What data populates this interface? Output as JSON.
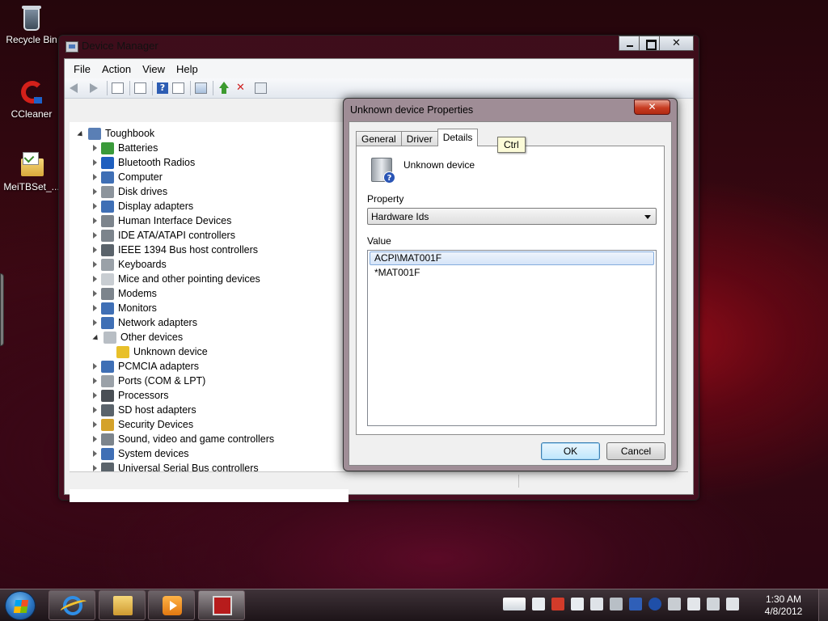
{
  "desktop": {
    "icons": [
      {
        "label": "Recycle Bin",
        "icon": "recycle-bin-icon"
      },
      {
        "label": "CCleaner",
        "icon": "ccleaner-icon"
      },
      {
        "label": "MeiTBSet_...",
        "icon": "settings-folder-icon"
      }
    ]
  },
  "device_manager": {
    "title": "Device Manager",
    "caption_buttons": {
      "close": "✕"
    },
    "menu": [
      "File",
      "Action",
      "View",
      "Help"
    ],
    "toolbar_help_glyph": "?",
    "toolbar_uninstall_glyph": "✕",
    "tree": {
      "root": "Toughbook",
      "items": [
        {
          "label": "Batteries",
          "icon": "battery-icon",
          "color": "#3a9a3a"
        },
        {
          "label": "Bluetooth Radios",
          "icon": "bluetooth-icon",
          "color": "#1f5fbf"
        },
        {
          "label": "Computer",
          "icon": "computer-icon",
          "color": "#3f6fb5"
        },
        {
          "label": "Disk drives",
          "icon": "disk-drive-icon",
          "color": "#8c949c"
        },
        {
          "label": "Display adapters",
          "icon": "display-adapter-icon",
          "color": "#3f6fb5"
        },
        {
          "label": "Human Interface Devices",
          "icon": "hid-icon",
          "color": "#7c848c"
        },
        {
          "label": "IDE ATA/ATAPI controllers",
          "icon": "ide-controller-icon",
          "color": "#7c848c"
        },
        {
          "label": "IEEE 1394 Bus host controllers",
          "icon": "ieee1394-icon",
          "color": "#5a636b"
        },
        {
          "label": "Keyboards",
          "icon": "keyboard-icon",
          "color": "#9aa1a8"
        },
        {
          "label": "Mice and other pointing devices",
          "icon": "mouse-icon",
          "color": "#c8cdd2"
        },
        {
          "label": "Modems",
          "icon": "modem-icon",
          "color": "#7c848c"
        },
        {
          "label": "Monitors",
          "icon": "monitor-icon",
          "color": "#3f6fb5"
        },
        {
          "label": "Network adapters",
          "icon": "network-adapter-icon",
          "color": "#3f6fb5"
        },
        {
          "label": "Other devices",
          "icon": "other-devices-icon",
          "color": "#b8bec4",
          "expanded": true
        },
        {
          "label": "Unknown device",
          "icon": "unknown-device-warning-icon",
          "color": "#e8c02a",
          "child": true
        },
        {
          "label": "PCMCIA adapters",
          "icon": "pcmcia-icon",
          "color": "#3f6fb5"
        },
        {
          "label": "Ports (COM & LPT)",
          "icon": "port-icon",
          "color": "#9aa1a8"
        },
        {
          "label": "Processors",
          "icon": "processor-icon",
          "color": "#4a4f55"
        },
        {
          "label": "SD host adapters",
          "icon": "sd-adapter-icon",
          "color": "#5a636b"
        },
        {
          "label": "Security Devices",
          "icon": "security-key-icon",
          "color": "#d4a22a"
        },
        {
          "label": "Sound, video and game controllers",
          "icon": "speaker-icon",
          "color": "#7c848c"
        },
        {
          "label": "System devices",
          "icon": "system-device-icon",
          "color": "#3f6fb5"
        },
        {
          "label": "Universal Serial Bus controllers",
          "icon": "usb-icon",
          "color": "#5a636b"
        }
      ]
    }
  },
  "properties_dialog": {
    "title": "Unknown device Properties",
    "close_glyph": "✕",
    "tabs": [
      {
        "label": "General",
        "active": false
      },
      {
        "label": "Driver",
        "active": false
      },
      {
        "label": "Details",
        "active": true
      }
    ],
    "tooltip": "Ctrl",
    "device_name": "Unknown device",
    "device_icon_glyph": "?",
    "property_label": "Property",
    "property_selected": "Hardware Ids",
    "value_label": "Value",
    "values": [
      {
        "text": "ACPI\\MAT001F",
        "selected": true
      },
      {
        "text": "*MAT001F",
        "selected": false
      }
    ],
    "ok_label": "OK",
    "cancel_label": "Cancel"
  },
  "taskbar": {
    "pinned": [
      {
        "name": "internet-explorer",
        "icon": "internet-explorer-icon"
      },
      {
        "name": "windows-explorer",
        "icon": "folder-icon"
      },
      {
        "name": "media-player",
        "icon": "media-player-icon"
      },
      {
        "name": "device-manager",
        "icon": "toolbox-icon"
      }
    ],
    "clock_time": "1:30 AM",
    "clock_date": "4/8/2012"
  }
}
